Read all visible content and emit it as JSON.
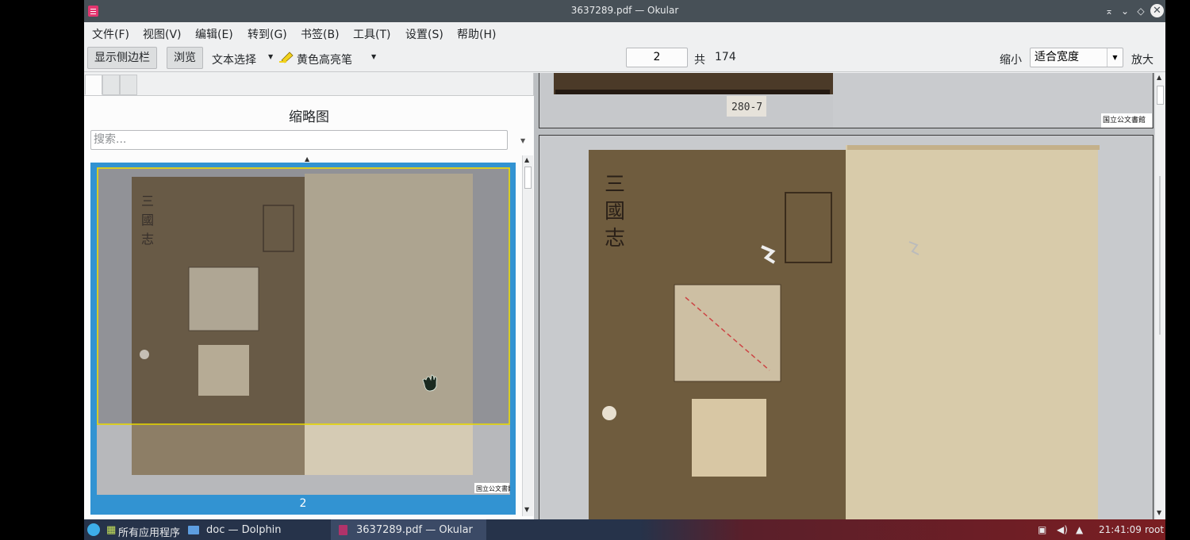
{
  "window": {
    "title": "3637289.pdf — Okular"
  },
  "titlebar_buttons": {
    "keep_above": "⌅",
    "minimize": "⌄",
    "maximize": "◇",
    "close": "✕"
  },
  "menu": [
    "文件(F)",
    "视图(V)",
    "编辑(E)",
    "转到(G)",
    "书签(B)",
    "工具(T)",
    "设置(S)",
    "帮助(H)"
  ],
  "toolbar": {
    "show_sidebar": "显示侧边栏",
    "browse": "浏览",
    "text_select": "文本选择",
    "highlighter": "黄色高亮笔",
    "page_current": "2",
    "page_of": "共",
    "page_total": "174",
    "zoom_out": "缩小",
    "zoom_mode": "适合宽度",
    "zoom_in": "放大"
  },
  "sidebar": {
    "title": "缩略图",
    "search_placeholder": "搜索...",
    "thumbnail_page": "2"
  },
  "document": {
    "page1_label": "280-7",
    "stamp_text": "国立公文書館"
  },
  "taskbar": {
    "apps_menu": "所有应用程序",
    "task1": "doc — Dolphin",
    "task2": "3637289.pdf — Okular",
    "clock": "21:41:09",
    "user": "root"
  },
  "colors": {
    "selection": "#3293d2",
    "titlebar": "#475057",
    "taskbar": "#26334a",
    "window_bg": "#eff0f1"
  }
}
